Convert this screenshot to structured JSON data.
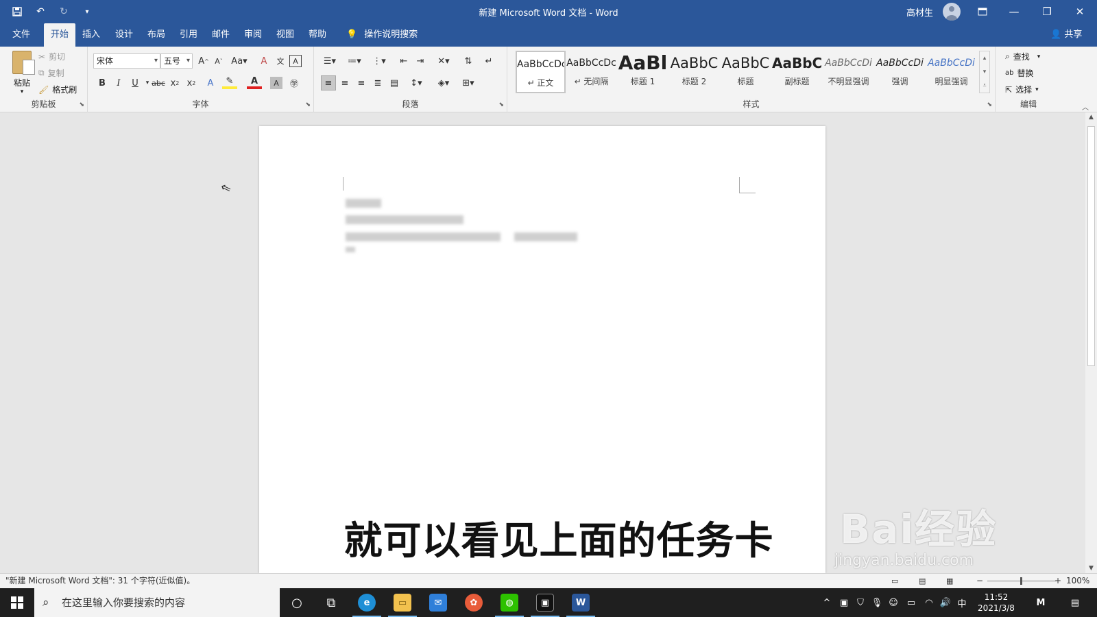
{
  "title_bar": {
    "doc_title": "新建 Microsoft Word 文档 - Word",
    "user_name": "高材生"
  },
  "tabs": [
    "文件",
    "开始",
    "插入",
    "设计",
    "布局",
    "引用",
    "邮件",
    "审阅",
    "视图",
    "帮助"
  ],
  "active_tab": "开始",
  "tell_me": "操作说明搜索",
  "share_label": "共享",
  "clipboard": {
    "paste": "粘贴",
    "cut": "剪切",
    "copy": "复制",
    "format_painter": "格式刷",
    "group_label": "剪贴板"
  },
  "font": {
    "name": "宋体",
    "size": "五号",
    "group_label": "字体"
  },
  "paragraph": {
    "group_label": "段落"
  },
  "styles": {
    "items": [
      {
        "preview": "AaBbCcDc",
        "name": "↵ 正文"
      },
      {
        "preview": "AaBbCcDc",
        "name": "↵ 无间隔"
      },
      {
        "preview": "AaBl",
        "name": "标题 1"
      },
      {
        "preview": "AaBbC",
        "name": "标题 2"
      },
      {
        "preview": "AaBbC",
        "name": "标题"
      },
      {
        "preview": "AaBbC",
        "name": "副标题"
      },
      {
        "preview": "AaBbCcDi",
        "name": "不明显强调"
      },
      {
        "preview": "AaBbCcDi",
        "name": "强调"
      },
      {
        "preview": "AaBbCcDi",
        "name": "明显强调"
      }
    ],
    "group_label": "样式"
  },
  "editing": {
    "find": "查找",
    "replace": "替换",
    "select": "选择",
    "group_label": "编辑"
  },
  "subtitle": "就可以看见上面的任务卡",
  "status": {
    "text": "\"新建 Microsoft Word 文档\": 31 个字符(近似值)。",
    "zoom": "100%"
  },
  "taskbar": {
    "search_placeholder": "在这里输入你要搜索的内容",
    "time": "11:52",
    "date": "2021/3/8",
    "ime": "中"
  },
  "watermark": {
    "brand": "Bai经验",
    "url": "jingyan.baidu.com"
  },
  "colors": {
    "word_blue": "#2b579a",
    "ribbon_bg": "#f3f3f3",
    "taskbar_bg": "#1f1f1f"
  }
}
